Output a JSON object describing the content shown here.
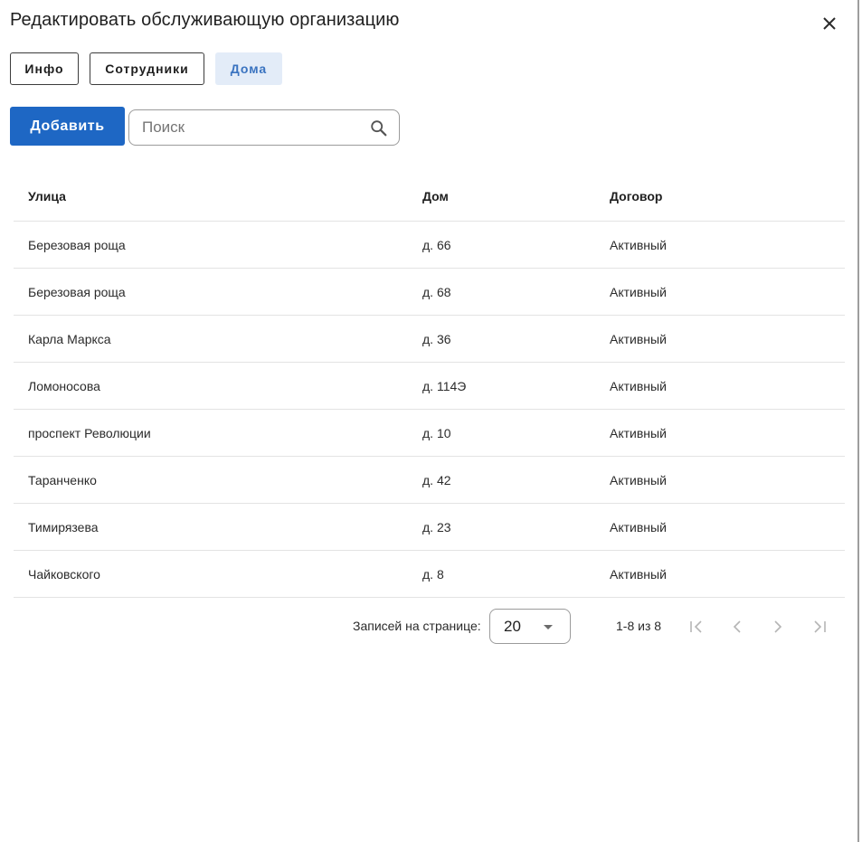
{
  "dialog": {
    "title": "Редактировать обслуживающую организацию",
    "close_icon": "close-icon"
  },
  "tabs": [
    {
      "label": "Инфо",
      "active": false
    },
    {
      "label": "Сотрудники",
      "active": false
    },
    {
      "label": "Дома",
      "active": true
    }
  ],
  "toolbar": {
    "add_label": "Добавить",
    "search_placeholder": "Поиск",
    "search_value": "",
    "search_icon": "search-icon"
  },
  "table": {
    "columns": [
      "Улица",
      "Дом",
      "Договор"
    ],
    "rows": [
      [
        "Березовая роща",
        "д. 66",
        "Активный"
      ],
      [
        "Березовая роща",
        "д. 68",
        "Активный"
      ],
      [
        "Карла Маркса",
        "д. 36",
        "Активный"
      ],
      [
        "Ломоносова",
        "д. 114Э",
        "Активный"
      ],
      [
        "проспект Революции",
        "д. 10",
        "Активный"
      ],
      [
        "Таранченко",
        "д. 42",
        "Активный"
      ],
      [
        "Тимирязева",
        "д. 23",
        "Активный"
      ],
      [
        "Чайковского",
        "д. 8",
        "Активный"
      ]
    ]
  },
  "pagination": {
    "rows_per_page_label": "Записей на странице:",
    "rows_per_page_value": "20",
    "range_text": "1-8 из 8",
    "nav_icons": [
      "first-page-icon",
      "prev-page-icon",
      "next-page-icon",
      "last-page-icon"
    ]
  },
  "colors": {
    "primary": "#1e67c4",
    "active_tab_bg": "#e3ecf8",
    "active_tab_text": "#3a73c0"
  }
}
